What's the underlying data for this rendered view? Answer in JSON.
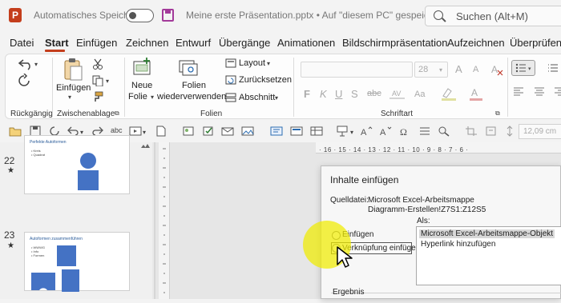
{
  "titlebar": {
    "autosave_label": "Automatisches Speichern",
    "doc_title": "Meine erste Präsentation.pptx • Auf \"diesem PC\" gespeichert",
    "search_placeholder": "Suchen (Alt+M)"
  },
  "tabs": [
    "Datei",
    "Start",
    "Einfügen",
    "Zeichnen",
    "Entwurf",
    "Übergänge",
    "Animationen",
    "Bildschirmpräsentation",
    "Aufzeichnen",
    "Überprüfen"
  ],
  "active_tab": "Start",
  "ribbon": {
    "undo_group": "Rückgängig",
    "clipboard_group": "Zwischenablage",
    "paste_label": "Einfügen",
    "slides_group": "Folien",
    "new_slide_label": "Neue",
    "new_slide_label2": "Folie",
    "reuse_label": "Folien",
    "reuse_label2": "wiederverwenden",
    "layout_label": "Layout",
    "reset_label": "Zurücksetzen",
    "section_label": "Abschnitt",
    "font_group": "Schriftart",
    "font_size": "28",
    "font_size_up": "A",
    "font_size_down": "A",
    "bold": "F",
    "italic": "K",
    "underline": "U",
    "strike": "S",
    "abc": "abc"
  },
  "qat": {
    "abc": "abc",
    "measure": "12,09 cm"
  },
  "ruler_top": "· 16 · 15 · 14 · 13 · 12 · 11 · 10 · 9 · 8 · 7 · 6 ·",
  "slides": [
    {
      "number": "22",
      "star": "★",
      "title": "Perfekte Autoformen",
      "bullets": [
        "• Kreis",
        "• Quadrat"
      ]
    },
    {
      "number": "23",
      "star": "★",
      "title": "Autoformen zusammenführen",
      "bullets": [
        "• WWWG",
        "   • Info",
        "   • Formen"
      ]
    }
  ],
  "dialog": {
    "title": "Inhalte einfügen",
    "source_label": "Quelldatei:",
    "source_line1": "Microsoft Excel-Arbeitsmappe",
    "source_line2": "Diagramm-Erstellen!Z7S1:Z12S5",
    "als_label": "Als:",
    "option_paste": "Einfügen",
    "option_link": "Verknüpfung einfügen",
    "list_items": [
      "Microsoft Excel-Arbeitsmappe-Objekt",
      "Hyperlink hinzufügen"
    ],
    "result_label": "Ergebnis"
  },
  "colors": {
    "accent": "#c43e1c",
    "highlight": "#f0eb00"
  }
}
